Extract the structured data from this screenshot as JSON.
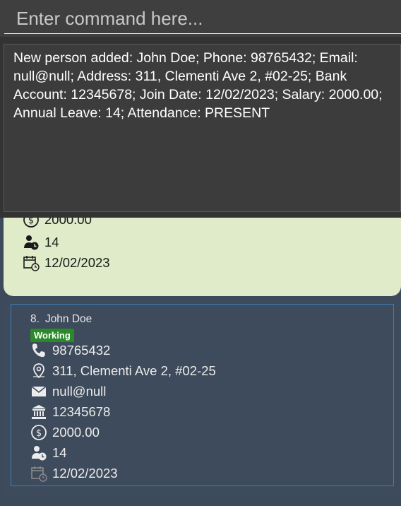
{
  "command": {
    "placeholder": "Enter command here..."
  },
  "result": {
    "text": "New person added: John Doe; Phone: 98765432; Email: null@null; Address: 311, Clementi Ave 2, #02-25; Bank Account: 12345678; Join Date: 12/02/2023; Salary: 2000.00; Annual Leave: 14; Attendance: PRESENT"
  },
  "prev_card": {
    "salary": "2000.00",
    "leave": "14",
    "join_date": "12/02/2023",
    "bg": "#e0ebc9"
  },
  "card": {
    "index": "8.",
    "name": "John Doe",
    "status": "Working",
    "phone": "98765432",
    "address": "311, Clementi Ave 2, #02-25",
    "email": "null@null",
    "bank": "12345678",
    "salary": "2000.00",
    "leave": "14",
    "join_date": "12/02/2023",
    "status_color": "#2a8a2a"
  },
  "icons": [
    "phone-icon",
    "location-icon",
    "email-icon",
    "bank-icon",
    "salary-icon",
    "leave-icon",
    "calendar-icon"
  ]
}
